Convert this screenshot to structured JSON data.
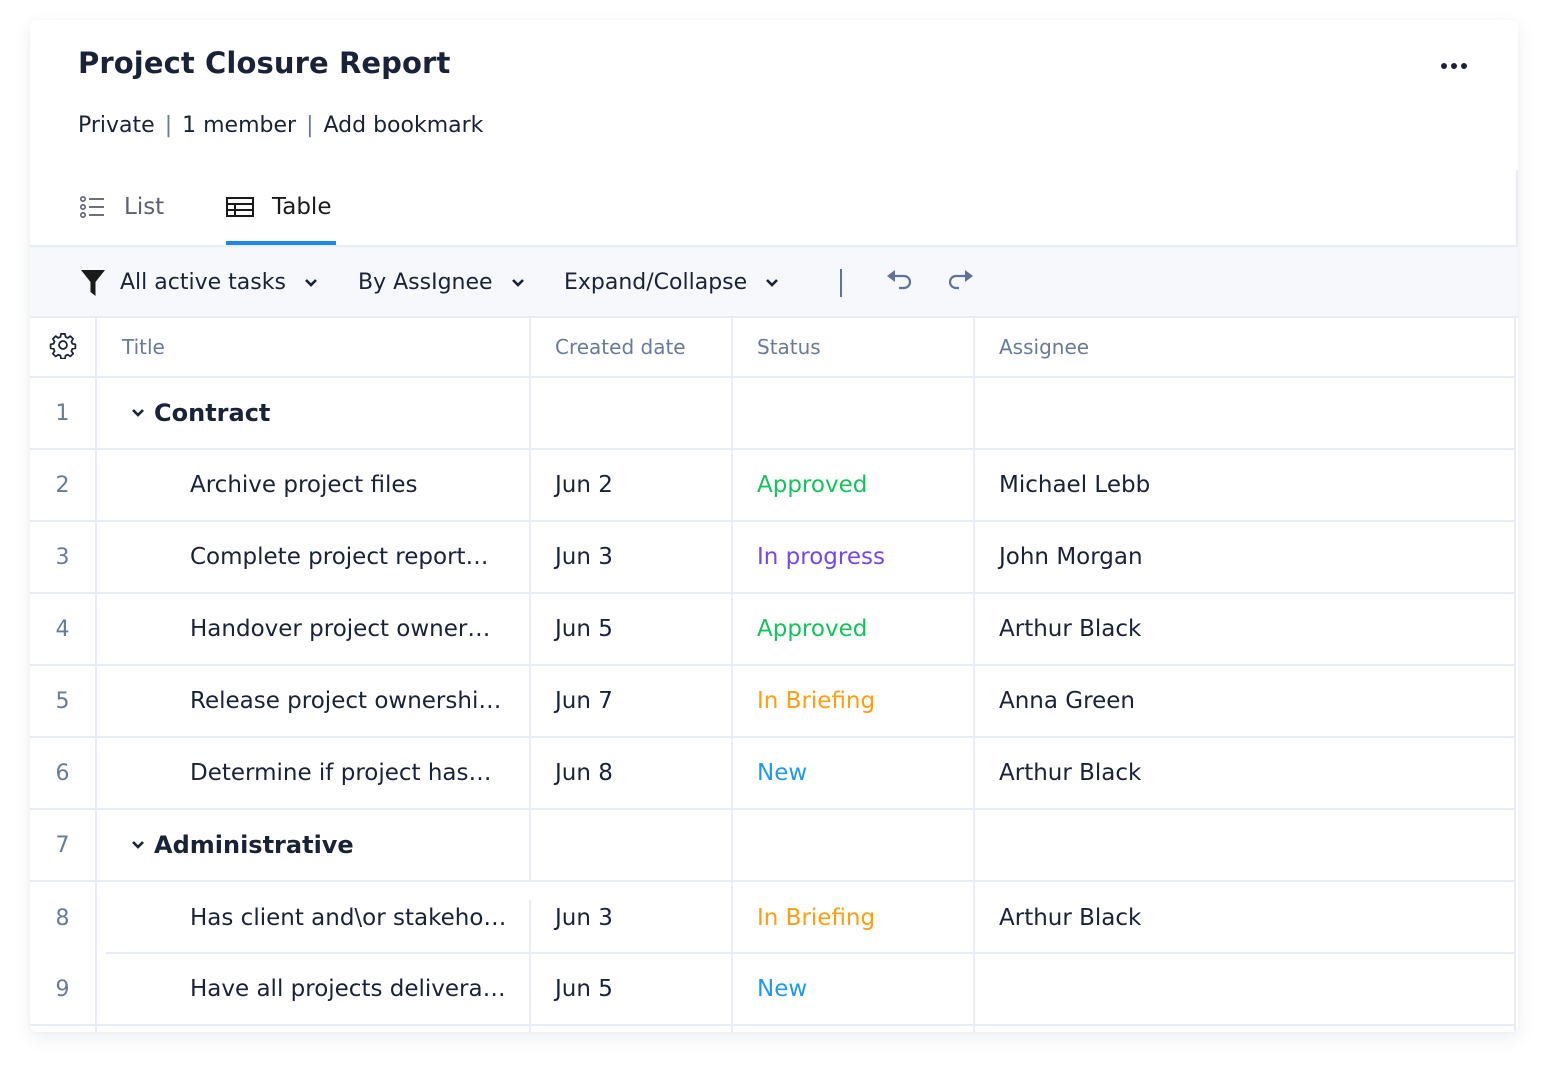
{
  "header": {
    "title": "Project Closure Report",
    "more_icon": "more-horizontal-icon",
    "meta": {
      "visibility": "Private",
      "members": "1 member",
      "bookmark": "Add bookmark"
    }
  },
  "tabs": [
    {
      "label": "List",
      "icon": "list-icon",
      "active": false
    },
    {
      "label": "Table",
      "icon": "table-icon",
      "active": true
    }
  ],
  "toolbar": {
    "filter": {
      "label": "All active tasks",
      "icon": "filter-icon"
    },
    "group_by": {
      "label": "By AssIgnee"
    },
    "expand": {
      "label": "Expand/Collapse"
    },
    "undo_icon": "undo-icon",
    "redo_icon": "redo-icon"
  },
  "table": {
    "settings_icon": "gear-icon",
    "columns": [
      "Title",
      "Created date",
      "Status",
      "Assignee"
    ],
    "rows": [
      {
        "num": "1",
        "type": "group",
        "title": "Contract",
        "date": "",
        "status": "",
        "assignee": ""
      },
      {
        "num": "2",
        "type": "task",
        "title": "Archive project files",
        "date": "Jun 2",
        "status": "Approved",
        "assignee": "Michael Lebb"
      },
      {
        "num": "3",
        "type": "task",
        "title": "Complete project report…",
        "date": "Jun 3",
        "status": "In progress",
        "assignee": "John Morgan"
      },
      {
        "num": "4",
        "type": "task",
        "title": "Handover project owner…",
        "date": "Jun 5",
        "status": "Approved",
        "assignee": "Arthur Black"
      },
      {
        "num": "5",
        "type": "task",
        "title": "Release project ownershi…",
        "date": "Jun 7",
        "status": "In Briefing",
        "assignee": "Anna Green"
      },
      {
        "num": "6",
        "type": "task",
        "title": "Determine if project has…",
        "date": "Jun 8",
        "status": "New",
        "assignee": "Arthur Black"
      },
      {
        "num": "7",
        "type": "group",
        "title": "Administrative",
        "date": "",
        "status": "",
        "assignee": ""
      },
      {
        "num": "8",
        "type": "task",
        "title": "Has client and\\or stakeho…",
        "date": "Jun 3",
        "status": "In Briefing",
        "assignee": "Arthur Black"
      },
      {
        "num": "9",
        "type": "task",
        "title": "Have all projects delivera…",
        "date": "Jun 5",
        "status": "New",
        "assignee": ""
      }
    ]
  },
  "status_colors": {
    "Approved": "#14c45a",
    "In progress": "#7447f0",
    "In Briefing": "#ff9e0f",
    "New": "#1e9bf0"
  },
  "accent_color": "#1a8ae6"
}
